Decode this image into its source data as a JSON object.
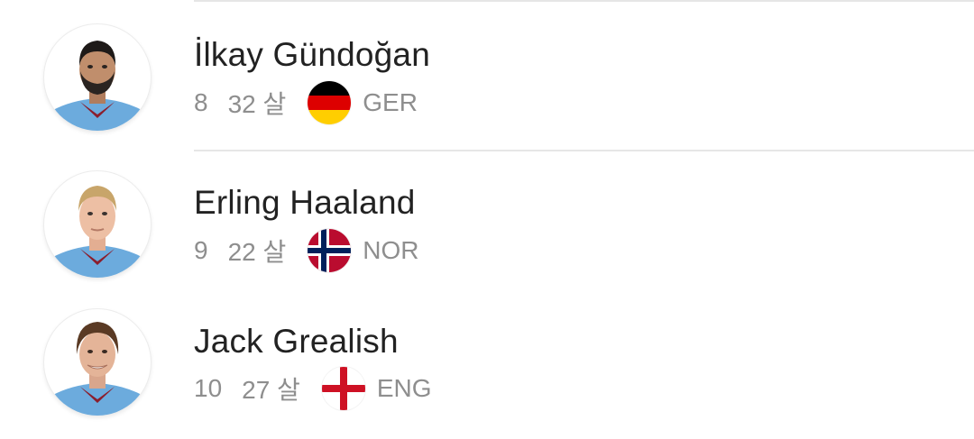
{
  "players": [
    {
      "name": "İlkay Gündoğan",
      "number": "8",
      "age": "32 살",
      "country_code": "GER",
      "flag_icon": "germany-flag-icon",
      "flag_colors": [
        "#000000",
        "#DD0000",
        "#FFCE00"
      ]
    },
    {
      "name": "Erling Haaland",
      "number": "9",
      "age": "22 살",
      "country_code": "NOR",
      "flag_icon": "norway-flag-icon",
      "flag_colors": [
        "#BA0C2F",
        "#FFFFFF",
        "#00205B"
      ]
    },
    {
      "name": "Jack Grealish",
      "number": "10",
      "age": "27 살",
      "country_code": "ENG",
      "flag_icon": "england-flag-icon",
      "flag_colors": [
        "#FFFFFF",
        "#CE1124"
      ]
    }
  ],
  "kit_colors": {
    "sky_blue": "#6CABDD",
    "maroon": "#8B1E2D"
  }
}
